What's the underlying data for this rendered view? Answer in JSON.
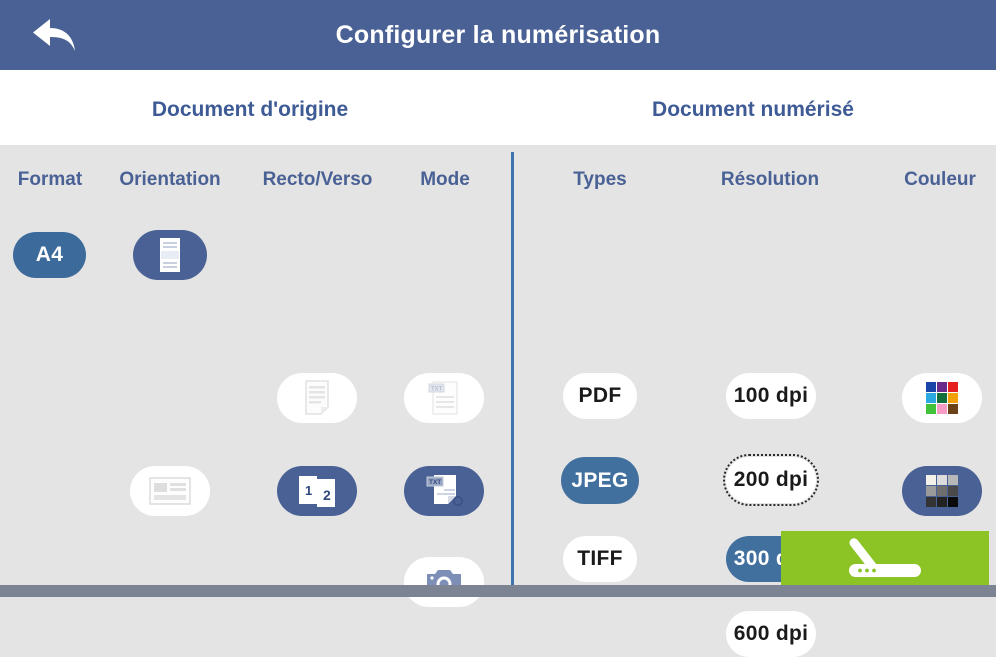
{
  "titlebar": {
    "back_icon": "back-arrow-icon",
    "title": "Configurer la numérisation"
  },
  "sections": {
    "origin": "Document d'origine",
    "scanned": "Document numérisé"
  },
  "columns": {
    "format": "Format",
    "orientation": "Orientation",
    "recto_verso": "Recto/Verso",
    "mode": "Mode",
    "types": "Types",
    "resolution": "Résolution",
    "couleur": "Couleur"
  },
  "format_options": [
    {
      "label": "A4",
      "selected": true
    }
  ],
  "orientation_options": [
    {
      "icon": "portrait-document-icon",
      "selected": true
    },
    {
      "icon": "landscape-document-icon",
      "selected": false
    }
  ],
  "recto_verso_options": [
    {
      "icon": "single-sided-page-icon",
      "selected": false
    },
    {
      "icon": "double-sided-pages-icon",
      "selected": true
    }
  ],
  "mode_options": [
    {
      "icon": "text-document-icon",
      "selected": false
    },
    {
      "icon": "text-and-image-icon",
      "selected": true
    },
    {
      "icon": "camera-photo-icon",
      "selected": false
    }
  ],
  "type_options": [
    {
      "label": "PDF",
      "selected": false
    },
    {
      "label": "JPEG",
      "selected": true
    },
    {
      "label": "TIFF",
      "selected": false
    }
  ],
  "resolution_options": [
    {
      "label": "100 dpi",
      "selected": false,
      "focused": false
    },
    {
      "label": "200 dpi",
      "selected": false,
      "focused": true
    },
    {
      "label": "300 dpi",
      "selected": true,
      "focused": false
    },
    {
      "label": "600 dpi",
      "selected": false,
      "focused": false
    }
  ],
  "couleur_options": [
    {
      "icon": "color-palette-icon",
      "selected": false
    },
    {
      "icon": "grayscale-palette-icon",
      "selected": true
    }
  ],
  "scan_button": {
    "icon": "flatbed-scanner-icon",
    "label": ""
  },
  "colors": {
    "titlebar_blue": "#4a6195",
    "accent_blue": "#3e5b96",
    "selected_blue": "#41709f",
    "divider_blue": "#4173ad",
    "body_gray": "#e4e4e4",
    "scan_green": "#8cc425",
    "bottom_bar": "#7c8494"
  }
}
